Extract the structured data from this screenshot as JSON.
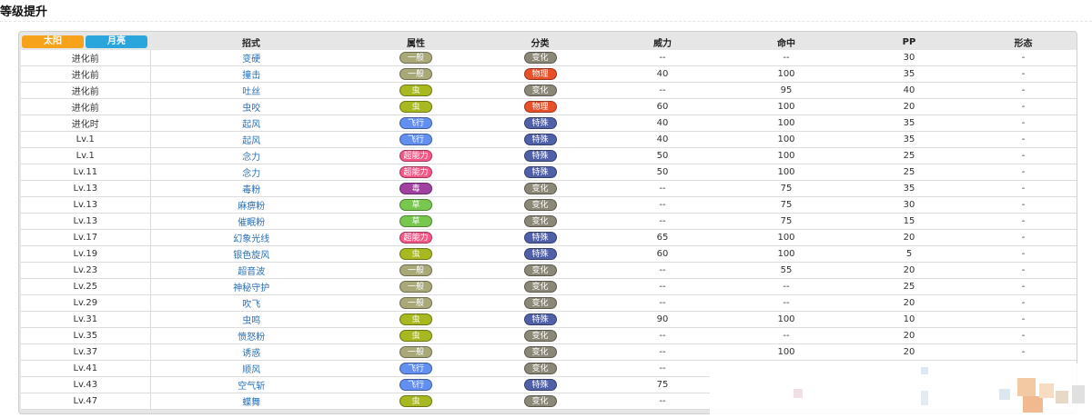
{
  "section_title": "等级提升",
  "form_tabs": [
    {
      "label": "太阳",
      "color": "#f7a21b"
    },
    {
      "label": "月亮",
      "color": "#2aa6dc"
    }
  ],
  "headers": {
    "move": "招式",
    "type": "属性",
    "category": "分类",
    "power": "威力",
    "accuracy": "命中",
    "pp": "PP",
    "form": "形态"
  },
  "type_colors": {
    "一般": "#a8a878",
    "虫": "#a8b820",
    "飞行": "#6390f0",
    "超能力": "#f85888",
    "毒": "#a040a0",
    "草": "#78c850"
  },
  "category_colors": {
    "变化": "#8c8878",
    "物理": "#e8502a",
    "特殊": "#5060a8"
  },
  "rows": [
    {
      "cond": "进化前",
      "move": "变硬",
      "type": "一般",
      "category": "变化",
      "power": "--",
      "accuracy": "--",
      "pp": "30",
      "form": "-"
    },
    {
      "cond": "进化前",
      "move": "撞击",
      "type": "一般",
      "category": "物理",
      "power": "40",
      "accuracy": "100",
      "pp": "35",
      "form": "-"
    },
    {
      "cond": "进化前",
      "move": "吐丝",
      "type": "虫",
      "category": "变化",
      "power": "--",
      "accuracy": "95",
      "pp": "40",
      "form": "-"
    },
    {
      "cond": "进化前",
      "move": "虫咬",
      "type": "虫",
      "category": "物理",
      "power": "60",
      "accuracy": "100",
      "pp": "20",
      "form": "-"
    },
    {
      "cond": "进化时",
      "move": "起风",
      "type": "飞行",
      "category": "特殊",
      "power": "40",
      "accuracy": "100",
      "pp": "35",
      "form": "-"
    },
    {
      "cond": "Lv.1",
      "move": "起风",
      "type": "飞行",
      "category": "特殊",
      "power": "40",
      "accuracy": "100",
      "pp": "35",
      "form": "-"
    },
    {
      "cond": "Lv.1",
      "move": "念力",
      "type": "超能力",
      "category": "特殊",
      "power": "50",
      "accuracy": "100",
      "pp": "25",
      "form": "-"
    },
    {
      "cond": "Lv.11",
      "move": "念力",
      "type": "超能力",
      "category": "特殊",
      "power": "50",
      "accuracy": "100",
      "pp": "25",
      "form": "-"
    },
    {
      "cond": "Lv.13",
      "move": "毒粉",
      "type": "毒",
      "category": "变化",
      "power": "--",
      "accuracy": "75",
      "pp": "35",
      "form": "-"
    },
    {
      "cond": "Lv.13",
      "move": "麻痹粉",
      "type": "草",
      "category": "变化",
      "power": "--",
      "accuracy": "75",
      "pp": "30",
      "form": "-"
    },
    {
      "cond": "Lv.13",
      "move": "催眠粉",
      "type": "草",
      "category": "变化",
      "power": "--",
      "accuracy": "75",
      "pp": "15",
      "form": "-"
    },
    {
      "cond": "Lv.17",
      "move": "幻象光线",
      "type": "超能力",
      "category": "特殊",
      "power": "65",
      "accuracy": "100",
      "pp": "20",
      "form": "-"
    },
    {
      "cond": "Lv.19",
      "move": "银色旋风",
      "type": "虫",
      "category": "特殊",
      "power": "60",
      "accuracy": "100",
      "pp": "5",
      "form": "-"
    },
    {
      "cond": "Lv.23",
      "move": "超音波",
      "type": "一般",
      "category": "变化",
      "power": "--",
      "accuracy": "55",
      "pp": "20",
      "form": "-"
    },
    {
      "cond": "Lv.25",
      "move": "神秘守护",
      "type": "一般",
      "category": "变化",
      "power": "--",
      "accuracy": "--",
      "pp": "25",
      "form": "-"
    },
    {
      "cond": "Lv.29",
      "move": "吹飞",
      "type": "一般",
      "category": "变化",
      "power": "--",
      "accuracy": "--",
      "pp": "20",
      "form": "-"
    },
    {
      "cond": "Lv.31",
      "move": "虫鸣",
      "type": "虫",
      "category": "特殊",
      "power": "90",
      "accuracy": "100",
      "pp": "10",
      "form": "-"
    },
    {
      "cond": "Lv.35",
      "move": "愤怒粉",
      "type": "虫",
      "category": "变化",
      "power": "--",
      "accuracy": "--",
      "pp": "20",
      "form": "-"
    },
    {
      "cond": "Lv.37",
      "move": "诱惑",
      "type": "一般",
      "category": "变化",
      "power": "--",
      "accuracy": "100",
      "pp": "20",
      "form": "-"
    },
    {
      "cond": "Lv.41",
      "move": "顺风",
      "type": "飞行",
      "category": "变化",
      "power": "--",
      "accuracy": "",
      "pp": "",
      "form": ""
    },
    {
      "cond": "Lv.43",
      "move": "空气斩",
      "type": "飞行",
      "category": "特殊",
      "power": "75",
      "accuracy": "",
      "pp": "",
      "form": ""
    },
    {
      "cond": "Lv.47",
      "move": "蝶舞",
      "type": "虫",
      "category": "变化",
      "power": "--",
      "accuracy": "",
      "pp": "",
      "form": ""
    }
  ]
}
